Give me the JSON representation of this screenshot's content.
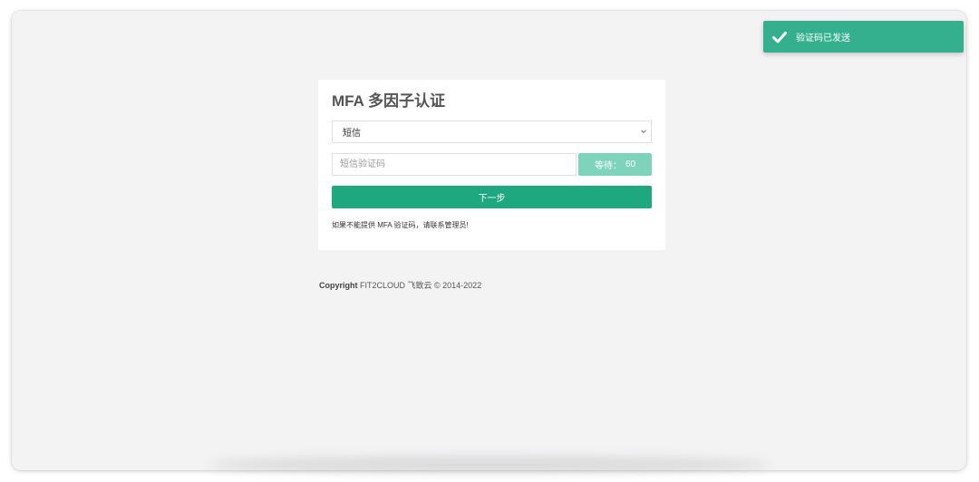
{
  "toast": {
    "icon": "check-icon",
    "message": "验证码已发送",
    "color": "#35b08e"
  },
  "login_card": {
    "title": "MFA 多因子认证",
    "method_select": {
      "selected": "短信"
    },
    "code_input": {
      "placeholder": "短信验证码",
      "value": ""
    },
    "wait_button": {
      "label": "等待：",
      "countdown": "60"
    },
    "next_button": {
      "label": "下一步"
    },
    "help_text": "如果不能提供 MFA 验证码，请联系管理员!"
  },
  "footer": {
    "copyright_label": "Copyright",
    "copyright_rest": "FIT2CLOUD 飞致云 © 2014-2022"
  },
  "colors": {
    "accent": "#1fa77f",
    "accent_light": "#7dd4bb",
    "background": "#f3f3f4"
  }
}
